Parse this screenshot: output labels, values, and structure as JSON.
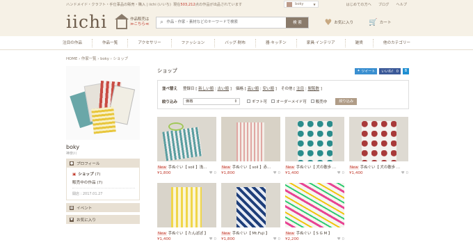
{
  "topbar": {
    "tagline": "ハンドメイド・クラフト・手仕事品の販売・購入 | iichi (いいち)",
    "count_prefix": "現在",
    "count": "503,212",
    "count_suffix": "点の作品が出品されています",
    "user": "boky",
    "link1": "はじめての方へ",
    "link2": "ブログ",
    "link3": "ヘルプ"
  },
  "header": {
    "logo": "iichi",
    "sell_line1": "作品販売は",
    "sell_line2": "≫こちら≪",
    "search_placeholder": "作品・作家・素材などのキーワードで検索",
    "search_button": "検 索",
    "fav": "お気に入り",
    "cart": "カート"
  },
  "categories": [
    "注目の作品",
    "作品一覧",
    "アクセサリー",
    "ファッション",
    "バッグ·財布",
    "器·キッチン",
    "家具·インテリア",
    "雑貨",
    "他のカテゴリー"
  ],
  "breadcrumb": "HOME › 作家一覧 › boky › ショップ",
  "sidebar": {
    "name": "boky",
    "pref": "神奈川",
    "profile": "プロフィール",
    "shop": "ショップ",
    "shop_count": "(7)",
    "sale": "販売中の作品",
    "sale_count": "(7)",
    "since": "開店 : 2017.01.27",
    "events": "イベント",
    "favs": "お気に入り"
  },
  "main": {
    "title": "ショップ",
    "tweet": "ツイート",
    "like": "いいね！ 0",
    "sort_label": "並べ替え",
    "reg_label": "登録日 [",
    "new": "新しい順",
    "sep": "|",
    "old": "古い順",
    "close": "]",
    "price_label": "価格 [",
    "high": "高い順",
    "low": "安い順",
    "other_label": "その他 [",
    "featured": "注目",
    "views": "閲覧数",
    "narrow_label": "絞り込み",
    "select": "価格",
    "gift": "ギフト可",
    "order": "オーダーメイド可",
    "onsale": "販売中",
    "narrow_btn": "絞り込み"
  },
  "products": [
    {
      "title": "手ぬぐい【 soil 】浅…",
      "price": "¥1,800",
      "likes": "0"
    },
    {
      "title": "手ぬぐい【 soil 】赤…",
      "price": "¥1,800",
      "likes": "0"
    },
    {
      "title": "手ぬぐい【 犬の散歩 …",
      "price": "¥1,400",
      "likes": "0"
    },
    {
      "title": "手ぬぐい【 犬の散歩 …",
      "price": "¥1,400",
      "likes": "0"
    },
    {
      "title": "手ぬぐい【 たんぽぽ 】",
      "price": "¥1,400",
      "likes": "0"
    },
    {
      "title": "手ぬぐい【 Mt.Fuji 】",
      "price": "¥1,800",
      "likes": "0"
    },
    {
      "title": "手ぬぐい【 S G M 】",
      "price": "¥2,200",
      "likes": "0"
    }
  ],
  "new_badge": "New"
}
